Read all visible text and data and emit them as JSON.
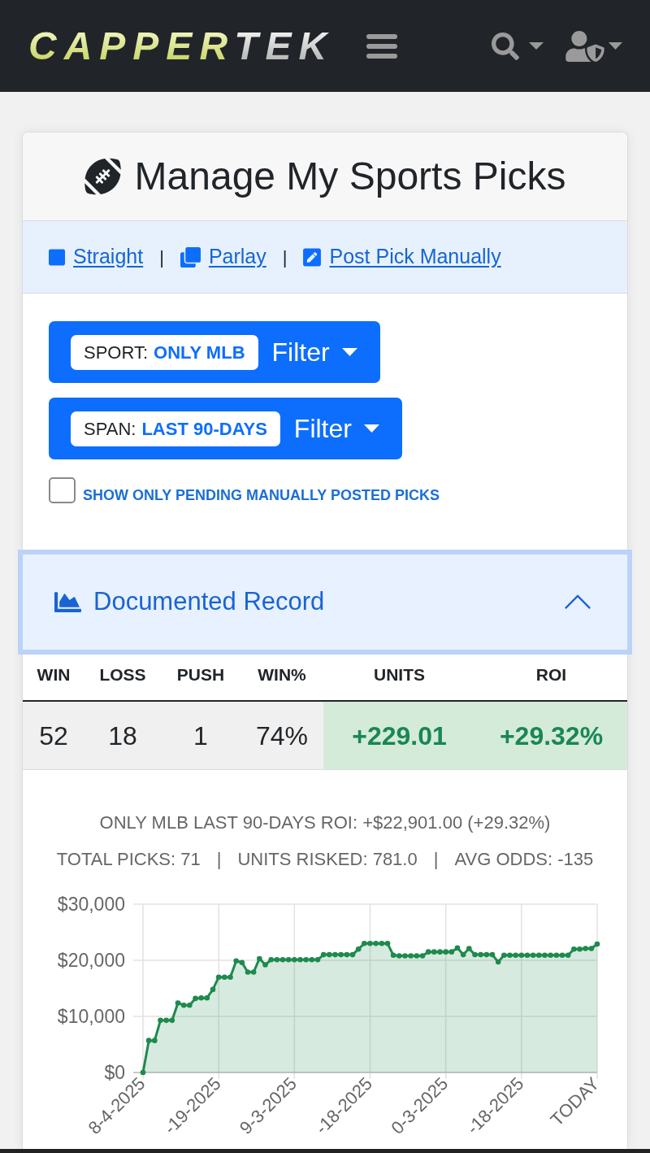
{
  "navbar": {
    "logo": {
      "primary": "CAPPER",
      "accent": "TEK"
    }
  },
  "picks_card": {
    "title": "Manage My Sports Picks",
    "link_bar": [
      {
        "kind": "link",
        "label": "Straight"
      },
      {
        "kind": "separator",
        "text": "|"
      },
      {
        "kind": "link",
        "label": "Parlay"
      },
      {
        "kind": "separator",
        "text": "|"
      },
      {
        "kind": "link",
        "label": "Post Pick Manually"
      }
    ],
    "filters": [
      {
        "label": "SPORT:",
        "value": "ONLY MLB",
        "button": "Filter"
      },
      {
        "label": "SPAN:",
        "value": "LAST 90-DAYS",
        "button": "Filter"
      }
    ],
    "pending_only": {
      "label": "SHOW ONLY PENDING MANUALLY POSTED PICKS",
      "checked": false
    }
  },
  "record": {
    "title": "Documented Record",
    "expanded": true,
    "table": {
      "columns": [
        "WIN",
        "LOSS",
        "PUSH",
        "WIN%",
        "UNITS",
        "ROI"
      ],
      "rows": [
        {
          "cells": [
            {
              "text": "52",
              "highlighted": false
            },
            {
              "text": "18",
              "highlighted": false
            },
            {
              "text": "1",
              "highlighted": false
            },
            {
              "text": "74%",
              "highlighted": false
            },
            {
              "text": "+229.01",
              "highlighted": true
            },
            {
              "text": "+29.32%",
              "highlighted": true
            }
          ]
        }
      ]
    },
    "summary": "ONLY MLB LAST 90-DAYS ROI: +$22,901.00 (+29.32%)",
    "stats": [
      "TOTAL PICKS: 71",
      "UNITS RISKED: 781.0",
      "AVG ODDS: -135"
    ],
    "stat_separators": [
      "|",
      "|"
    ],
    "chart_data": {
      "type": "area",
      "grid": true,
      "categories": [
        "8-4-2025",
        null,
        null,
        null,
        null,
        null,
        null,
        null,
        null,
        null,
        null,
        null,
        null,
        "-19-2025",
        null,
        null,
        null,
        null,
        null,
        null,
        null,
        null,
        null,
        null,
        null,
        null,
        "9-3-2025",
        null,
        null,
        null,
        null,
        null,
        null,
        null,
        null,
        null,
        null,
        null,
        null,
        "-18-2025",
        null,
        null,
        null,
        null,
        null,
        null,
        null,
        null,
        null,
        null,
        null,
        null,
        "0-3-2025",
        null,
        null,
        null,
        null,
        null,
        null,
        null,
        null,
        null,
        null,
        null,
        null,
        "-18-2025",
        null,
        null,
        null,
        null,
        null,
        null,
        null,
        null,
        null,
        null,
        null,
        null,
        "TODAY"
      ],
      "series": [
        {
          "color": "#1f8a4d",
          "values": [
            0,
            5700,
            5700,
            9300,
            9300,
            9300,
            12400,
            12000,
            12000,
            13200,
            13300,
            13300,
            14800,
            17000,
            17000,
            17000,
            19900,
            19600,
            17900,
            17900,
            20300,
            19200,
            20100,
            20100,
            20100,
            20100,
            20100,
            20100,
            20100,
            20100,
            20100,
            21000,
            21000,
            21000,
            21000,
            21000,
            21000,
            22000,
            23000,
            23000,
            23000,
            23000,
            23000,
            20900,
            20800,
            20800,
            20800,
            20800,
            20800,
            21500,
            21500,
            21500,
            21500,
            21500,
            22200,
            21000,
            22100,
            21000,
            21000,
            21000,
            21000,
            19700,
            20900,
            20900,
            20900,
            20900,
            20900,
            20900,
            20900,
            20900,
            20900,
            20900,
            20900,
            20900,
            22000,
            22000,
            22100,
            22100,
            22900
          ]
        }
      ],
      "ylim": [
        0,
        30000
      ],
      "yticks": [
        {
          "value": 0,
          "label": "$0"
        },
        {
          "value": 10000,
          "label": "$10,000"
        },
        {
          "value": 20000,
          "label": "$20,000"
        },
        {
          "value": 30000,
          "label": "$30,000"
        }
      ]
    }
  }
}
